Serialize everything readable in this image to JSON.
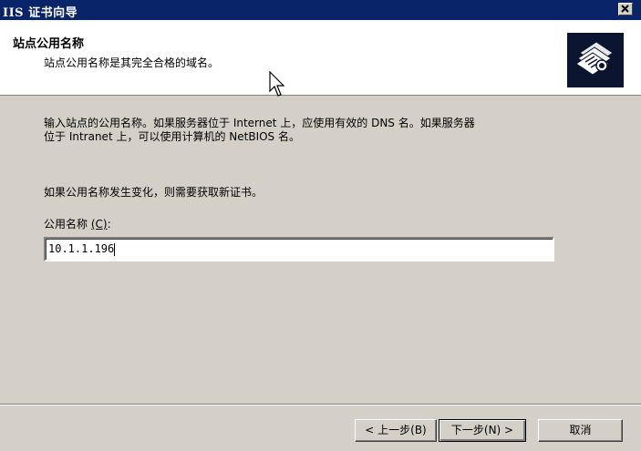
{
  "window": {
    "title": "IIS 证书向导",
    "close_symbol": "×"
  },
  "header": {
    "title": "站点公用名称",
    "subtitle": "站点公用名称是其完全合格的域名。",
    "icon": "certificate-wizard-icon"
  },
  "body": {
    "paragraph1_line1": "输入站点的公用名称。如果服务器位于 Internet 上，应使用有效的 DNS 名。如果服务器",
    "paragraph1_line2": "位于 Intranet 上，可以使用计算机的 NetBIOS 名。",
    "paragraph2": "如果公用名称发生变化，则需要获取新证书。",
    "field_label": "公用名称",
    "field_accel": "(C)",
    "field_colon": ":",
    "field_value": "10.1.1.196"
  },
  "buttons": {
    "back": "< 上一步(B)",
    "next": "下一步(N) >",
    "cancel": "取消"
  }
}
